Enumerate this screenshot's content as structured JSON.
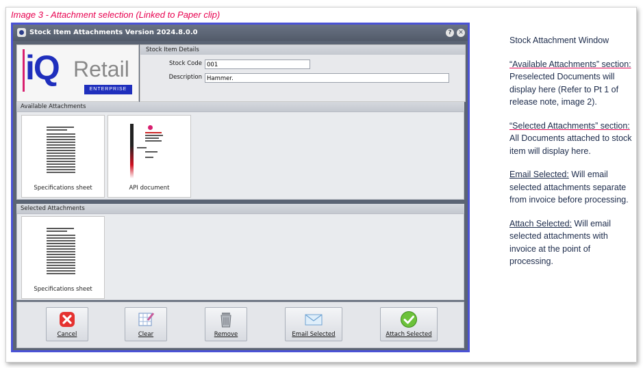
{
  "caption": "Image 3 - Attachment selection (Linked to Paper clip)",
  "window": {
    "title": "Stock Item Attachments Version 2024.8.0.0",
    "help_glyph": "?",
    "close_glyph": "✕"
  },
  "logo": {
    "iq": "iQ",
    "retail": "Retail",
    "enterprise": "ENTERPRISE"
  },
  "details": {
    "header": "Stock Item Details",
    "stock_code_label": "Stock Code",
    "stock_code_value": "001",
    "description_label": "Description",
    "description_value": "Hammer."
  },
  "available": {
    "header": "Available Attachments",
    "items": [
      {
        "caption": "Specifications sheet"
      },
      {
        "caption": "API document"
      }
    ]
  },
  "selected": {
    "header": "Selected Attachments",
    "items": [
      {
        "caption": "Specifications sheet"
      }
    ]
  },
  "toolbar": {
    "cancel": "Cancel",
    "clear": "Clear",
    "remove": "Remove",
    "email": "Email Selected",
    "attach": "Attach Selected"
  },
  "notes": {
    "title": "Stock Attachment Window",
    "available_title": "“Available Attachments” section:",
    "available_text": " Preselected Documents will display here (Refer to Pt 1 of release note, image 2).",
    "selected_title": "“Selected Attachments” section:",
    "selected_text": " All Documents attached to stock item will display here.",
    "email_title": "Email Selected:",
    "email_text": " Will email selected attachments separate from invoice before processing.",
    "attach_title": "Attach Selected:",
    "attach_text": " Will email selected attachments with invoice at the point of processing."
  },
  "colors": {
    "caption": "#e8004f",
    "window_border": "#4a52d6",
    "brand_blue": "#1f2fbd",
    "brand_pink": "#d81f6f"
  },
  "icons": {
    "cancel": "cancel-x-icon",
    "clear": "clear-table-icon",
    "remove": "trash-can-icon",
    "email": "envelope-icon",
    "attach": "checkmark-icon"
  }
}
